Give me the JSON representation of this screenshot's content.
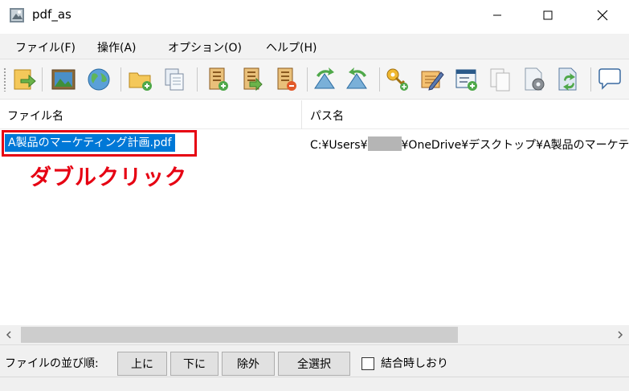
{
  "window": {
    "title": "pdf_as"
  },
  "menu": [
    "ファイル(F)",
    "操作(A)",
    "オプション(O)",
    "ヘルプ(H)"
  ],
  "toolbar": {
    "icons": [
      "open-file-icon",
      "picture-icon",
      "globe-icon",
      "add-folder-icon",
      "copy-pages-icon",
      "add-pages-icon",
      "insert-pages-icon",
      "remove-pages-icon",
      "rotate-left-icon",
      "rotate-right-icon",
      "add-key-icon",
      "edit-icon",
      "add-form-icon",
      "blank-page-icon",
      "settings-page-icon",
      "refresh-page-icon",
      "comment-icon"
    ]
  },
  "list": {
    "columns": [
      "ファイル名",
      "パス名"
    ],
    "rows": [
      {
        "name": "A製品のマーケティング計画.pdf",
        "path_prefix": "C:¥Users¥",
        "path_suffix": "¥OneDrive¥デスクトップ¥A製品のマーケテ"
      }
    ],
    "annotation": "ダブルクリック"
  },
  "bottom": {
    "order_label": "ファイルの並び順:",
    "buttons": [
      "上に",
      "下に",
      "除外",
      "全選択"
    ],
    "checkbox_label": "結合時しおり",
    "checkbox_checked": false
  },
  "colors": {
    "selection": "#0078d7",
    "annotation": "#e60012"
  }
}
